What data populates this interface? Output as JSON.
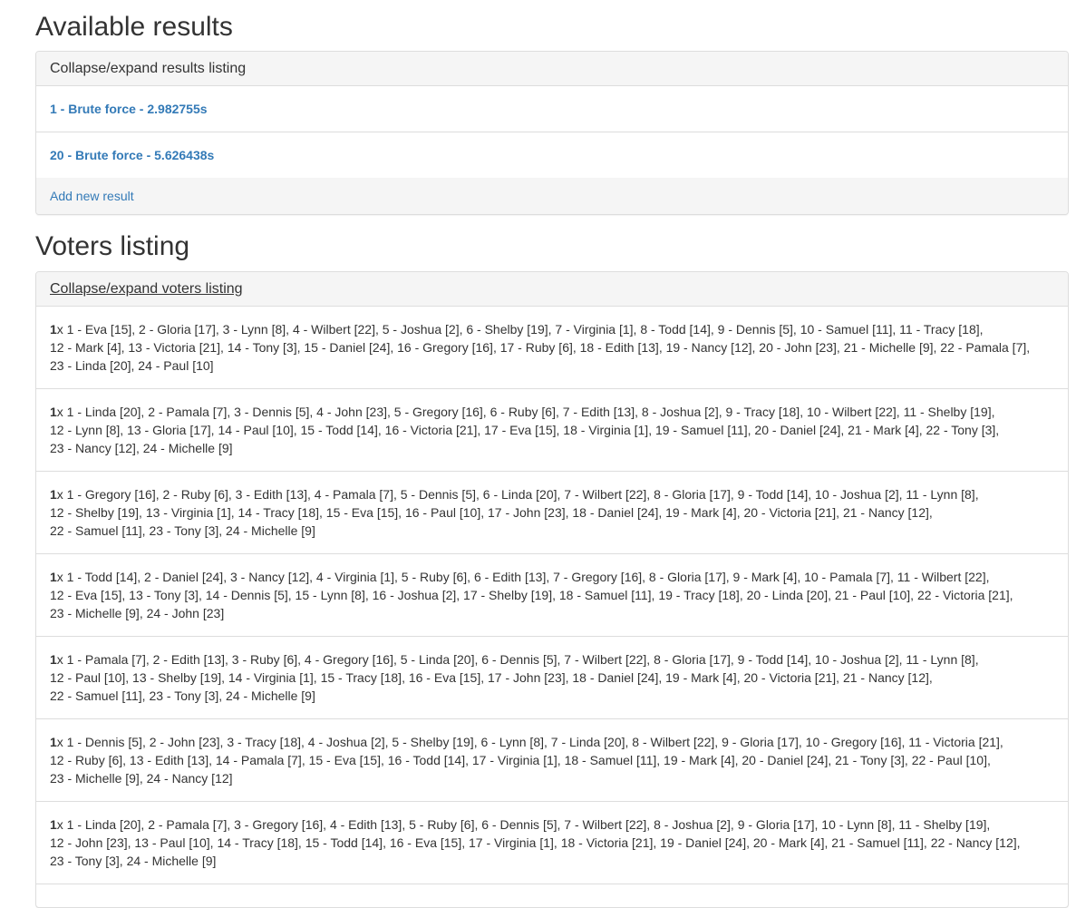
{
  "results_section": {
    "title": "Available results",
    "toggle_label": "Collapse/expand results listing",
    "items": [
      {
        "label": "1 - Brute force - 2.982755s"
      },
      {
        "label": "20 - Brute force - 5.626438s"
      }
    ],
    "add_label": "Add new result"
  },
  "voters_section": {
    "title": "Voters listing",
    "toggle_label": "Collapse/expand voters listing",
    "voters": [
      {
        "count": "1",
        "suffix": "x",
        "lines": [
          " 1 - Eva [15], 2 - Gloria [17], 3 - Lynn [8], 4 - Wilbert [22], 5 - Joshua [2], 6 - Shelby [19], 7 - Virginia [1], 8 - Todd [14], 9 - Dennis [5], 10 - Samuel [11], 11 - Tracy [18],",
          "12 - Mark [4], 13 - Victoria [21], 14 - Tony [3], 15 - Daniel [24], 16 - Gregory [16], 17 - Ruby [6], 18 - Edith [13], 19 - Nancy [12], 20 - John [23], 21 - Michelle [9], 22 - Pamala [7],",
          "23 - Linda [20], 24 - Paul [10]"
        ]
      },
      {
        "count": "1",
        "suffix": "x",
        "lines": [
          " 1 - Linda [20], 2 - Pamala [7], 3 - Dennis [5], 4 - John [23], 5 - Gregory [16], 6 - Ruby [6], 7 - Edith [13], 8 - Joshua [2], 9 - Tracy [18], 10 - Wilbert [22], 11 - Shelby [19],",
          "12 - Lynn [8], 13 - Gloria [17], 14 - Paul [10], 15 - Todd [14], 16 - Victoria [21], 17 - Eva [15], 18 - Virginia [1], 19 - Samuel [11], 20 - Daniel [24], 21 - Mark [4], 22 - Tony [3],",
          "23 - Nancy [12], 24 - Michelle [9]"
        ]
      },
      {
        "count": "1",
        "suffix": "x",
        "lines": [
          " 1 - Gregory [16], 2 - Ruby [6], 3 - Edith [13], 4 - Pamala [7], 5 - Dennis [5], 6 - Linda [20], 7 - Wilbert [22], 8 - Gloria [17], 9 - Todd [14], 10 - Joshua [2], 11 - Lynn [8],",
          "12 - Shelby [19], 13 - Virginia [1], 14 - Tracy [18], 15 - Eva [15], 16 - Paul [10], 17 - John [23], 18 - Daniel [24], 19 - Mark [4], 20 - Victoria [21], 21 - Nancy [12],",
          "22 - Samuel [11], 23 - Tony [3], 24 - Michelle [9]"
        ]
      },
      {
        "count": "1",
        "suffix": "x",
        "lines": [
          " 1 - Todd [14], 2 - Daniel [24], 3 - Nancy [12], 4 - Virginia [1], 5 - Ruby [6], 6 - Edith [13], 7 - Gregory [16], 8 - Gloria [17], 9 - Mark [4], 10 - Pamala [7], 11 - Wilbert [22],",
          "12 - Eva [15], 13 - Tony [3], 14 - Dennis [5], 15 - Lynn [8], 16 - Joshua [2], 17 - Shelby [19], 18 - Samuel [11], 19 - Tracy [18], 20 - Linda [20], 21 - Paul [10], 22 - Victoria [21],",
          "23 - Michelle [9], 24 - John [23]"
        ]
      },
      {
        "count": "1",
        "suffix": "x",
        "lines": [
          " 1 - Pamala [7], 2 - Edith [13], 3 - Ruby [6], 4 - Gregory [16], 5 - Linda [20], 6 - Dennis [5], 7 - Wilbert [22], 8 - Gloria [17], 9 - Todd [14], 10 - Joshua [2], 11 - Lynn [8],",
          "12 - Paul [10], 13 - Shelby [19], 14 - Virginia [1], 15 - Tracy [18], 16 - Eva [15], 17 - John [23], 18 - Daniel [24], 19 - Mark [4], 20 - Victoria [21], 21 - Nancy [12],",
          "22 - Samuel [11], 23 - Tony [3], 24 - Michelle [9]"
        ]
      },
      {
        "count": "1",
        "suffix": "x",
        "lines": [
          " 1 - Dennis [5], 2 - John [23], 3 - Tracy [18], 4 - Joshua [2], 5 - Shelby [19], 6 - Lynn [8], 7 - Linda [20], 8 - Wilbert [22], 9 - Gloria [17], 10 - Gregory [16], 11 - Victoria [21],",
          "12 - Ruby [6], 13 - Edith [13], 14 - Pamala [7], 15 - Eva [15], 16 - Todd [14], 17 - Virginia [1], 18 - Samuel [11], 19 - Mark [4], 20 - Daniel [24], 21 - Tony [3], 22 - Paul [10],",
          "23 - Michelle [9], 24 - Nancy [12]"
        ]
      },
      {
        "count": "1",
        "suffix": "x",
        "lines": [
          " 1 - Linda [20], 2 - Pamala [7], 3 - Gregory [16], 4 - Edith [13], 5 - Ruby [6], 6 - Dennis [5], 7 - Wilbert [22], 8 - Joshua [2], 9 - Gloria [17], 10 - Lynn [8], 11 - Shelby [19],",
          "12 - John [23], 13 - Paul [10], 14 - Tracy [18], 15 - Todd [14], 16 - Eva [15], 17 - Virginia [1], 18 - Victoria [21], 19 - Daniel [24], 20 - Mark [4], 21 - Samuel [11], 22 - Nancy [12],",
          "23 - Tony [3], 24 - Michelle [9]"
        ]
      }
    ]
  }
}
